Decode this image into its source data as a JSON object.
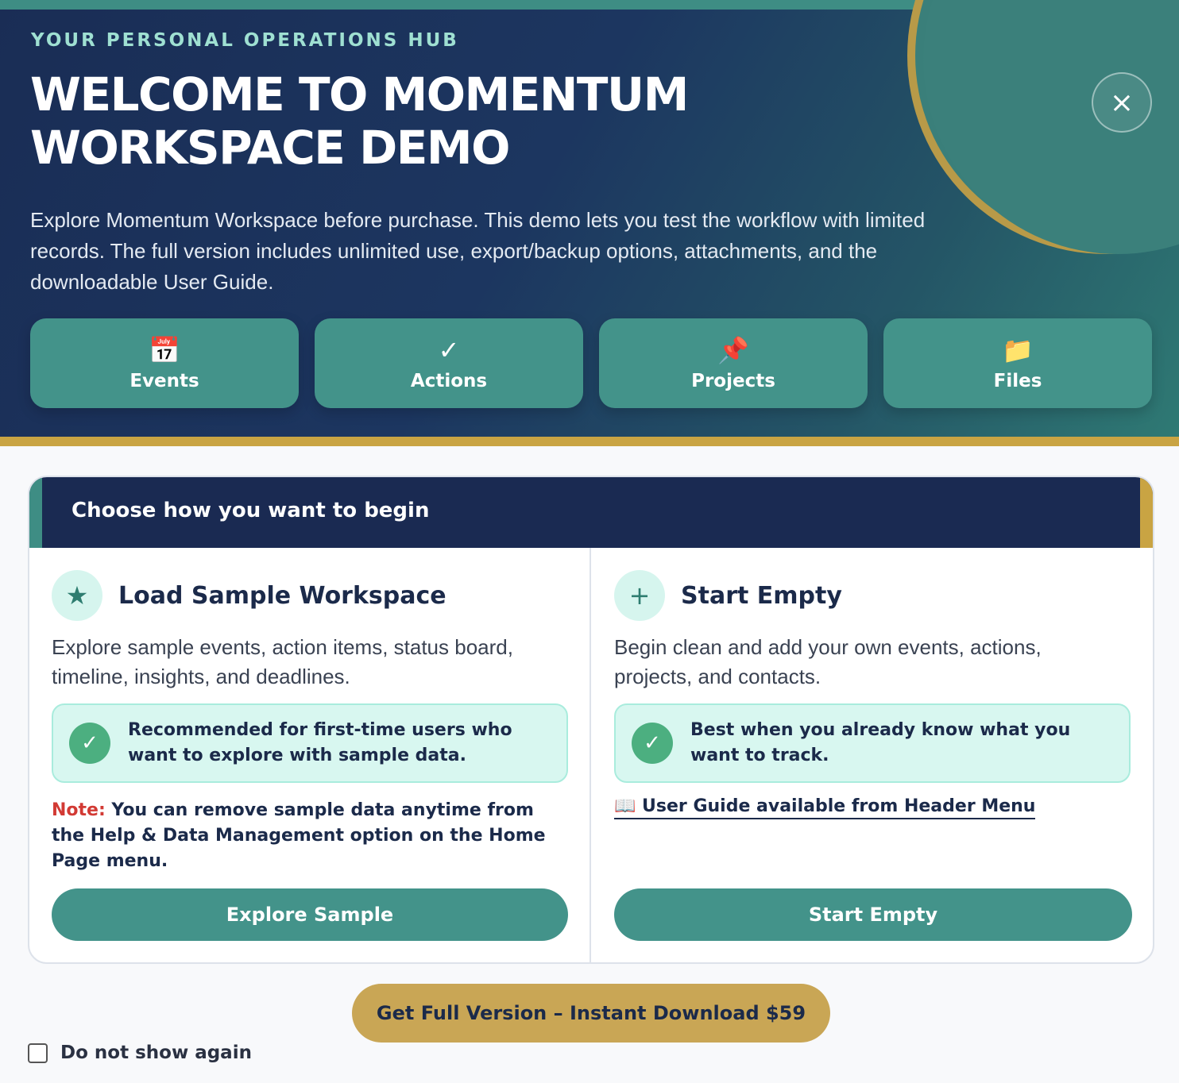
{
  "hero": {
    "eyebrow": "YOUR PERSONAL OPERATIONS HUB",
    "title": "WELCOME TO MOMENTUM WORKSPACE DEMO",
    "description": "Explore Momentum Workspace before purchase. This demo lets you test the workflow with limited records. The full version includes unlimited use, export/backup options, attachments, and the downloadable User Guide.",
    "close_icon": "×",
    "features": [
      {
        "icon": "📅",
        "icon_name": "calendar-icon",
        "label": "Events"
      },
      {
        "icon": "✓",
        "icon_name": "checkmark-icon",
        "label": "Actions"
      },
      {
        "icon": "📌",
        "icon_name": "pushpin-icon",
        "label": "Projects"
      },
      {
        "icon": "📁",
        "icon_name": "folder-icon",
        "label": "Files"
      }
    ]
  },
  "card": {
    "heading": "Choose how you want to begin",
    "sample": {
      "icon": "★",
      "title": "Load Sample Workspace",
      "description": "Explore sample events, action items, status board, timeline, insights, and deadlines.",
      "recommendation": "Recommended for first-time users who want to explore with sample data.",
      "note_label": "Note:",
      "note_text_1": " You can remove sample data anytime from the ",
      "note_bold": "Help & Data Management",
      "note_text_2": " option on the Home Page menu.",
      "button": "Explore Sample"
    },
    "empty": {
      "icon": "+",
      "title": "Start Empty",
      "description": "Begin clean and add your own events, actions, projects, and contacts.",
      "recommendation": "Best when you already know what you want to track.",
      "guide_link": "📖 User Guide available from Header Menu",
      "button": "Start Empty"
    },
    "check_icon": "✓"
  },
  "footer": {
    "buy_button": "Get Full Version – Instant Download $59",
    "dont_show": "Do not show again"
  },
  "colors": {
    "navy": "#1a2a52",
    "teal": "#43938a",
    "gold": "#c9a655",
    "note_red": "#d23a34"
  }
}
